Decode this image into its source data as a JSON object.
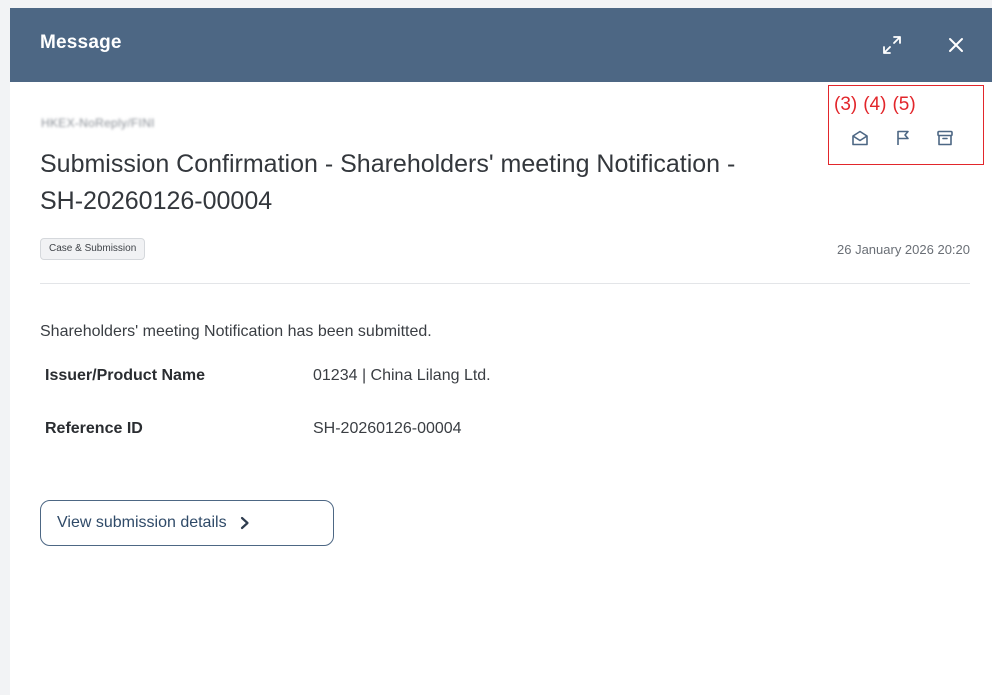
{
  "header": {
    "title": "Message",
    "expand_icon": "expand-arrows-icon",
    "close_icon": "close-icon"
  },
  "message": {
    "sender": "HKEX-NoReply/FINI",
    "subject": "Submission Confirmation - Shareholders' meeting Notification - SH-20260126-00004",
    "tag": "Case & Submission",
    "date": "26 January 2026 20:20",
    "body": "Shareholders' meeting Notification has been submitted.",
    "fields": [
      {
        "label": "Issuer/Product Name",
        "value": "01234 | China Lilang Ltd."
      },
      {
        "label": "Reference ID",
        "value": "SH-20260126-00004"
      }
    ],
    "view_button": "View submission details"
  },
  "annotations": {
    "labels": [
      "(3)",
      "(4)",
      "(5)"
    ],
    "color": "#e2262b"
  },
  "actions": [
    {
      "name": "mark-unread",
      "icon": "open-envelope-icon"
    },
    {
      "name": "flag",
      "icon": "flag-icon"
    },
    {
      "name": "archive",
      "icon": "archive-box-icon"
    }
  ],
  "colors": {
    "header_bg": "#4d6784",
    "accent": "#4d6784"
  }
}
